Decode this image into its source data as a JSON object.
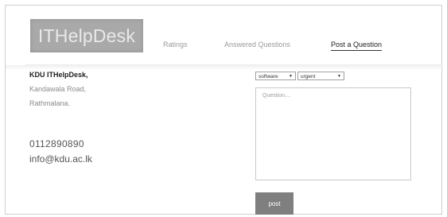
{
  "header": {
    "logo": "ITHelpDesk",
    "nav": [
      {
        "label": "Ratings",
        "active": false
      },
      {
        "label": "Answered Questions",
        "active": false
      },
      {
        "label": "Post a Question",
        "active": true
      }
    ]
  },
  "contact": {
    "name": "KDU ITHelpDesk,",
    "address_line_1": "Kandawala Road,",
    "address_line_2": "Rathmalana.",
    "phone": "0112890890",
    "email": "info@kdu.ac.lk"
  },
  "form": {
    "category": {
      "selected": "software"
    },
    "priority": {
      "selected": "urgent"
    },
    "question": {
      "value": "",
      "placeholder": "Question...."
    },
    "post_label": "post"
  },
  "colors": {
    "logo_background": "#a9a9a9",
    "button_background": "#7f7f7f",
    "active_nav": "#222222",
    "inactive_nav": "#9a9a9a"
  }
}
